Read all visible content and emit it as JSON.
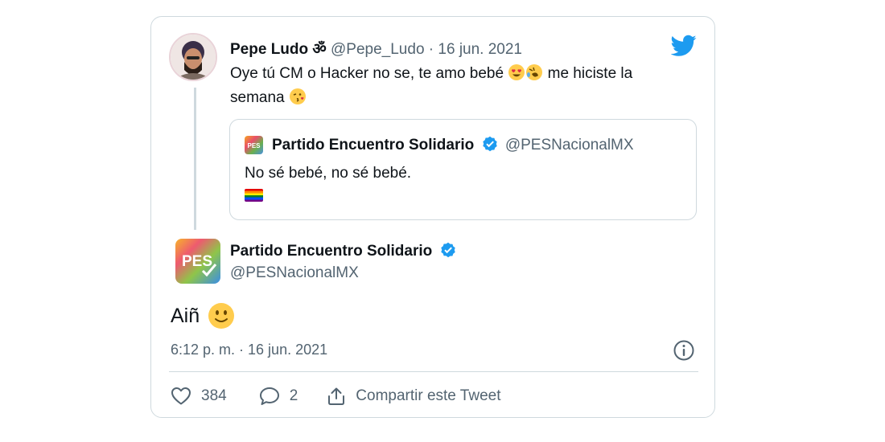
{
  "colors": {
    "twitter_blue": "#1d9bf0",
    "secondary_text": "#536471",
    "border": "#cfd9de"
  },
  "reply_tweet": {
    "display_name": "Pepe Ludo ॐ",
    "handle": "@Pepe_Ludo",
    "separator": "·",
    "date": "16 jun. 2021",
    "text_part1": "Oye tú CM o Hacker no se, te amo bebé",
    "text_part2": "me hiciste la semana",
    "emojis": [
      "heart-eyes-emoji",
      "rofl-emoji",
      "kiss-emoji"
    ]
  },
  "quoted_tweet": {
    "display_name": "Partido Encuentro Solidario",
    "handle": "@PESNacionalMX",
    "text": "No sé bebé, no sé bebé.",
    "attachment": "rainbow-flag-emoji"
  },
  "main_tweet": {
    "avatar_text": "PES",
    "display_name": "Partido Encuentro Solidario",
    "handle": "@PESNacionalMX",
    "text": "Aiñ",
    "emoji": "slightly-smiling-emoji",
    "timestamp": "6:12 p. m. · 16 jun. 2021"
  },
  "actions": {
    "likes": "384",
    "replies": "2",
    "share_label": "Compartir este Tweet"
  },
  "icons": [
    "twitter-bird-icon",
    "verified-badge-icon",
    "info-icon",
    "heart-icon",
    "comment-icon",
    "share-icon"
  ]
}
